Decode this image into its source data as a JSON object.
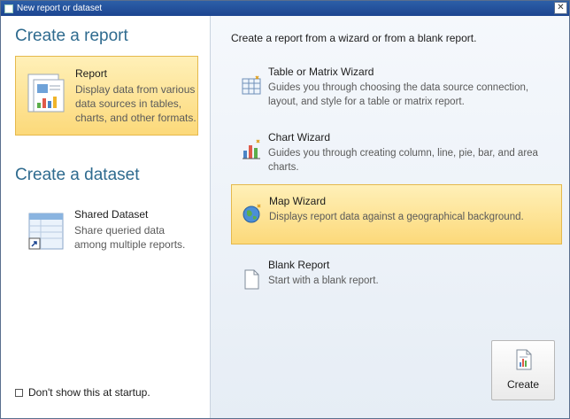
{
  "window": {
    "title": "New report or dataset",
    "close_glyph": "✕"
  },
  "left": {
    "create_report_heading": "Create a report",
    "report_card": {
      "title": "Report",
      "description": "Display data from various data sources in tables, charts, and other formats."
    },
    "create_dataset_heading": "Create a dataset",
    "dataset_card": {
      "title": "Shared Dataset",
      "description": "Share queried data among multiple reports."
    },
    "startup_checkbox_label": "Don't show this at startup."
  },
  "right": {
    "intro": "Create a report from a wizard or from a blank report.",
    "wizards": [
      {
        "title": "Table or Matrix Wizard",
        "description": "Guides you through choosing the data source connection, layout, and style for a table or matrix report.",
        "icon": "table-wizard-icon"
      },
      {
        "title": "Chart Wizard",
        "description": "Guides you through creating column, line, pie, bar, and area charts.",
        "icon": "chart-wizard-icon"
      },
      {
        "title": "Map Wizard",
        "description": "Displays report data against a geographical background.",
        "icon": "map-wizard-icon",
        "selected": true
      },
      {
        "title": "Blank Report",
        "description": "Start with a blank report.",
        "icon": "blank-report-icon"
      }
    ],
    "create_button_label": "Create"
  },
  "colors": {
    "selected_bg_top": "#fff0b8",
    "selected_bg_bottom": "#fcd97a",
    "heading": "#2f6b8f",
    "title_bar": "#2c5fa8"
  }
}
